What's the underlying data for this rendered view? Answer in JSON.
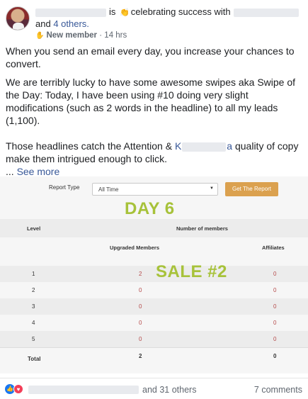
{
  "header": {
    "action_text": "is",
    "activity_text": "celebrating success with",
    "others_prefix": "and",
    "others_link": "4 others.",
    "badge": "New member",
    "separator": "·",
    "time": "14 hrs",
    "activity_icon": "clapping-hands-icon",
    "badge_icon": "new-member-icon"
  },
  "post": {
    "paragraph1": "When you send an email every day, you increase your chances to convert.",
    "paragraph2": "We are terribly lucky to have some awesome swipes aka Swipe of the Day: Today, I have been using #10 doing very slight modifications (such as 2 words in the headline) to all my leads (1,100).",
    "paragraph3_start": "Those headlines catch the Attention &",
    "paragraph3_k": "K",
    "paragraph3_a": "a",
    "paragraph3_end": "quality of copy make them intrigued enough to click.",
    "see_more_prefix": "...",
    "see_more": "See more"
  },
  "report": {
    "filter_label": "Report Type",
    "filter_value": "All Time",
    "button_label": "Get The Report",
    "overlay_day": "DAY 6",
    "overlay_sale": "SALE #2",
    "columns": {
      "level": "Level",
      "number_of_members": "Number of members",
      "upgraded": "Upgraded Members",
      "affiliates": "Affiliates"
    },
    "rows": [
      {
        "level": "1",
        "upgraded": "2",
        "affiliates": "0"
      },
      {
        "level": "2",
        "upgraded": "0",
        "affiliates": "0"
      },
      {
        "level": "3",
        "upgraded": "0",
        "affiliates": "0"
      },
      {
        "level": "4",
        "upgraded": "0",
        "affiliates": "0"
      },
      {
        "level": "5",
        "upgraded": "0",
        "affiliates": "0"
      }
    ],
    "total": {
      "label": "Total",
      "upgraded": "2",
      "affiliates": "0"
    },
    "colors": {
      "button": "#dba14f",
      "overlay": "#a7c23a",
      "value_red": "#b54a4a"
    }
  },
  "footer": {
    "reactors_suffix": "and 31 others",
    "comments": "7 comments",
    "like_icon": "like-reaction-icon",
    "love_icon": "love-reaction-icon"
  }
}
